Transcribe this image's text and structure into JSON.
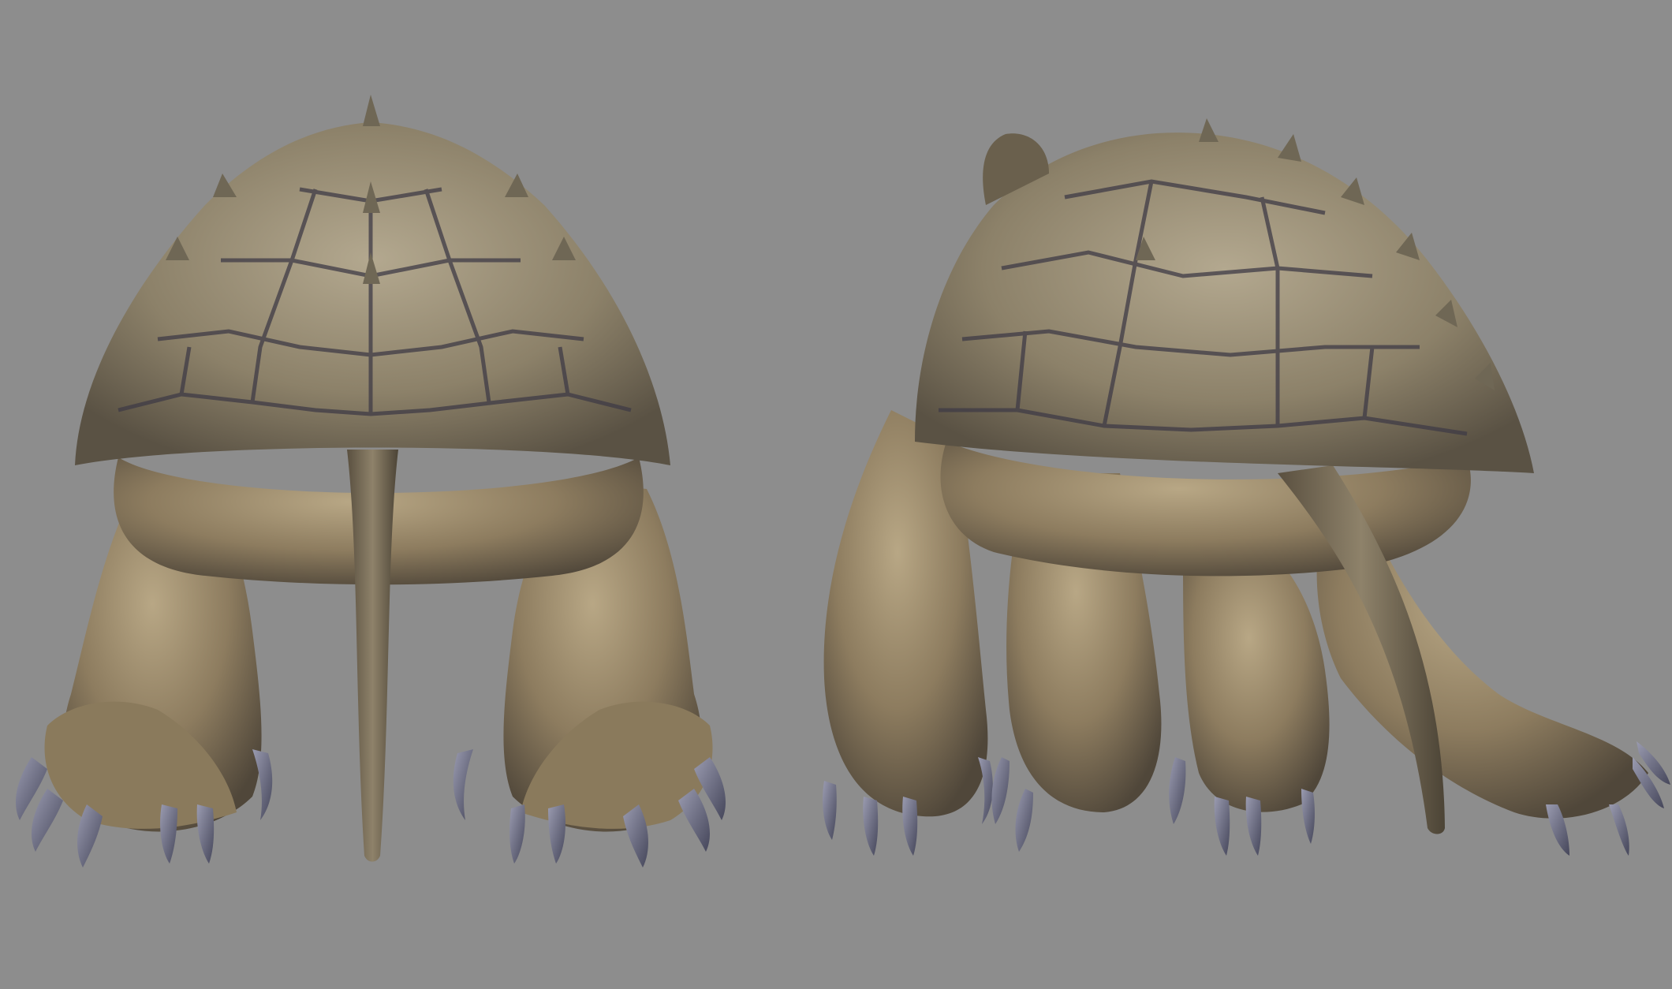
{
  "scene": {
    "background": "#8d8d8d",
    "views": [
      {
        "name": "back-view"
      },
      {
        "name": "three-quarter-back-view"
      }
    ],
    "palette": {
      "skin_base": "#8a7a5e",
      "skin_light": "#b9a888",
      "skin_dark": "#4e4536",
      "shell_base": "#7f7560",
      "shell_light": "#b0a58d",
      "shell_groove": "#3e3a44",
      "claw": "#5b5c6e",
      "claw_light": "#8c8da0"
    }
  }
}
